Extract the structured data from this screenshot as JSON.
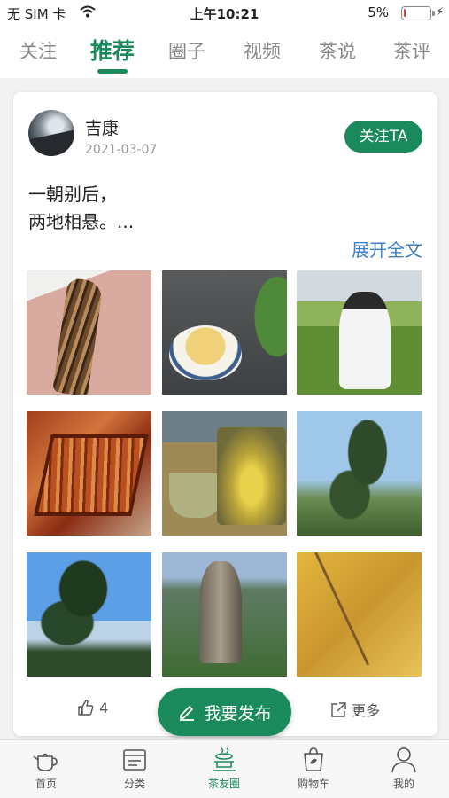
{
  "status_bar": {
    "carrier": "无 SIM 卡",
    "time": "上午10:21",
    "battery_percent": "5%",
    "battery_level": 0.05
  },
  "tabs": [
    {
      "label": "关注",
      "active": false
    },
    {
      "label": "推荐",
      "active": true
    },
    {
      "label": "圈子",
      "active": false
    },
    {
      "label": "视频",
      "active": false
    },
    {
      "label": "茶说",
      "active": false
    },
    {
      "label": "茶评",
      "active": false
    }
  ],
  "post": {
    "username": "吉康",
    "date": "2021-03-07",
    "follow_label": "关注TA",
    "text_lines": [
      "一朝别后，",
      "两地相悬。..."
    ],
    "expand_label": "展开全文",
    "like_count": "4",
    "more_label": "更多"
  },
  "publish_label": "我要发布",
  "bottom_nav": [
    {
      "label": "首页",
      "icon": "teapot-icon",
      "active": false
    },
    {
      "label": "分类",
      "icon": "category-icon",
      "active": false
    },
    {
      "label": "茶友圈",
      "icon": "tea-friends-icon",
      "active": true
    },
    {
      "label": "购物车",
      "icon": "cart-bag-icon",
      "active": false
    },
    {
      "label": "我的",
      "icon": "person-icon",
      "active": false
    }
  ],
  "colors": {
    "accent": "#1a8a5c",
    "link": "#3d7dc3"
  }
}
